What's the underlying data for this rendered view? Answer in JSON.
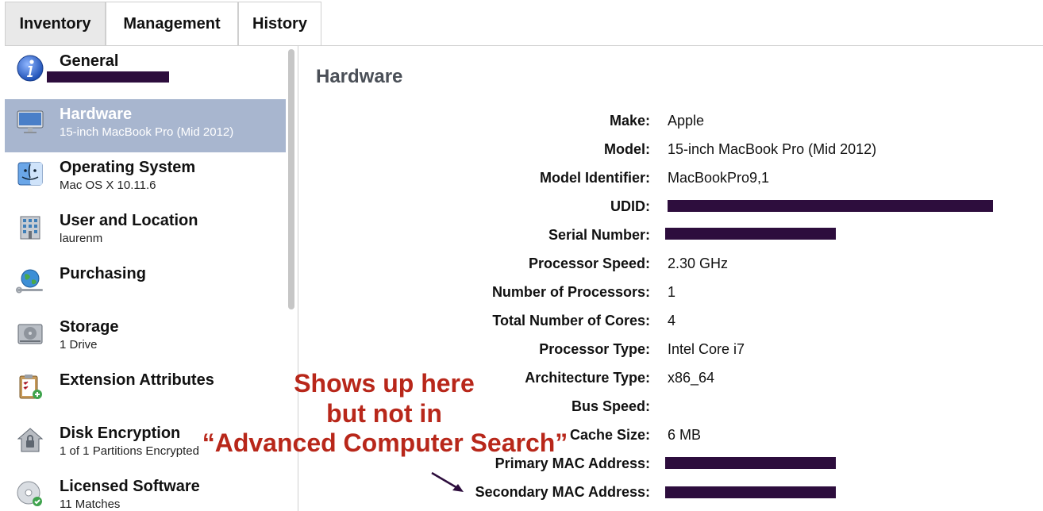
{
  "tabs": [
    {
      "label": "Inventory"
    },
    {
      "label": "Management"
    },
    {
      "label": "History"
    }
  ],
  "sidebar": {
    "items": [
      {
        "title": "General",
        "subtitle": "",
        "icon": "info-icon"
      },
      {
        "title": "Hardware",
        "subtitle": "15-inch MacBook Pro (Mid 2012)",
        "icon": "monitor-icon"
      },
      {
        "title": "Operating System",
        "subtitle": "Mac OS X 10.11.6",
        "icon": "finder-icon"
      },
      {
        "title": "User and Location",
        "subtitle": "laurenm",
        "icon": "building-icon"
      },
      {
        "title": "Purchasing",
        "subtitle": "",
        "icon": "globe-wrench-icon"
      },
      {
        "title": "Storage",
        "subtitle": "1 Drive",
        "icon": "drive-icon"
      },
      {
        "title": "Extension Attributes",
        "subtitle": "",
        "icon": "clipboard-add-icon"
      },
      {
        "title": "Disk Encryption",
        "subtitle": "1 of 1 Partitions Encrypted",
        "icon": "house-lock-icon"
      },
      {
        "title": "Licensed Software",
        "subtitle": "11 Matches",
        "icon": "disc-check-icon"
      }
    ]
  },
  "main": {
    "title": "Hardware",
    "rows": [
      {
        "label": "Make:",
        "value": "Apple"
      },
      {
        "label": "Model:",
        "value": "15-inch MacBook Pro (Mid 2012)"
      },
      {
        "label": "Model Identifier:",
        "value": "MacBookPro9,1"
      },
      {
        "label": "UDID:",
        "value": ""
      },
      {
        "label": "Serial Number:",
        "value": ""
      },
      {
        "label": "Processor Speed:",
        "value": "2.30 GHz"
      },
      {
        "label": "Number of Processors:",
        "value": "1"
      },
      {
        "label": "Total Number of Cores:",
        "value": "4"
      },
      {
        "label": "Processor Type:",
        "value": "Intel Core i7"
      },
      {
        "label": "Architecture Type:",
        "value": "x86_64"
      },
      {
        "label": "Bus Speed:",
        "value": ""
      },
      {
        "label": "Cache Size:",
        "value": "6 MB"
      },
      {
        "label": "Primary MAC Address:",
        "value": ""
      },
      {
        "label": "Secondary MAC Address:",
        "value": ""
      }
    ]
  },
  "annotation": {
    "line1": "Shows up here",
    "line2": "but not in",
    "line3": "“Advanced Computer Search”"
  },
  "colors": {
    "selected_bg": "#a8b6cf",
    "redaction": "#2d0d3d",
    "annotation": "#b8271a"
  }
}
